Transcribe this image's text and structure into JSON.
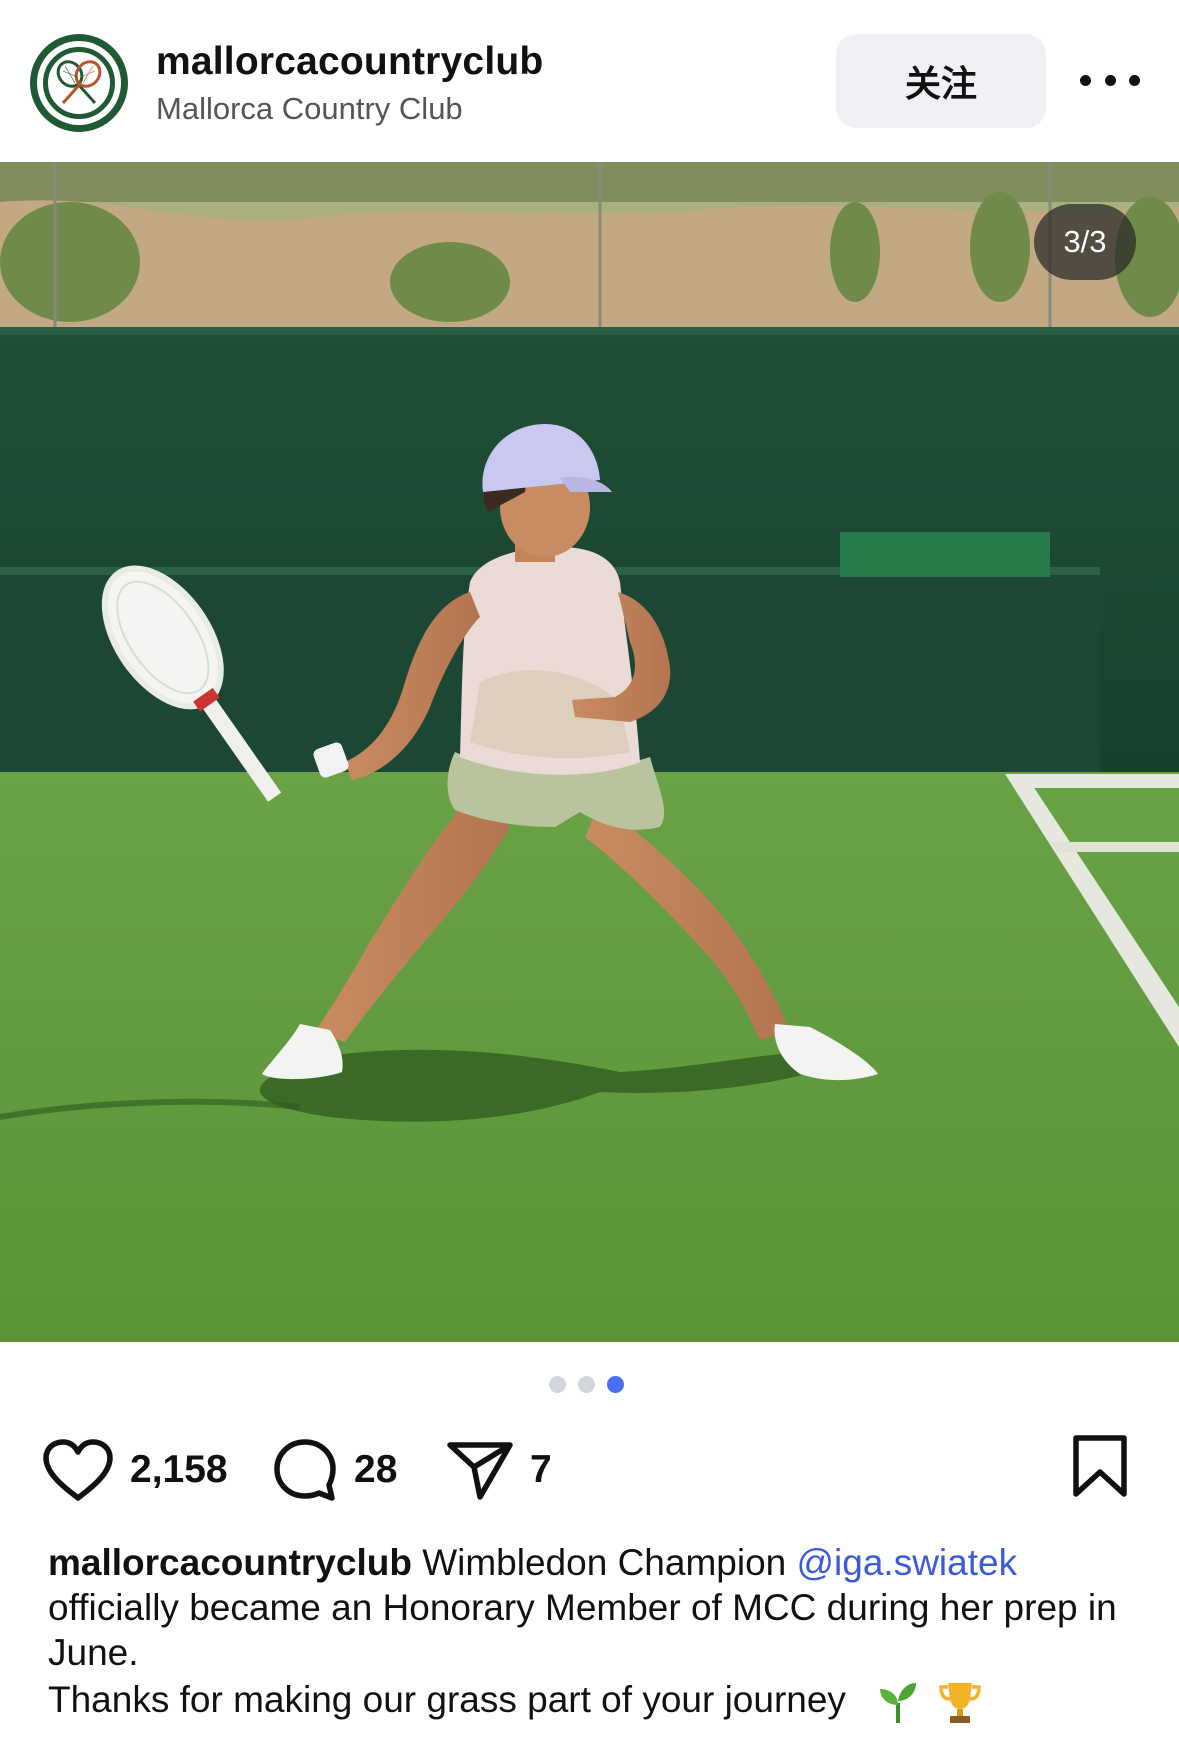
{
  "post": {
    "account": {
      "username": "mallorcacountryclub",
      "display_name": "Mallorca Country Club"
    },
    "follow_label": "关注",
    "image_counter": "3/3",
    "carousel": {
      "total": 3,
      "current": 3
    },
    "stats": {
      "likes": "2,158",
      "comments": "28",
      "shares": "7"
    },
    "caption": {
      "username": "mallorcacountryclub",
      "text_1": " Wimbledon Champion ",
      "mention": "@iga.swiatek",
      "text_2": " officially became an Honorary Member of MCC during her prep in June.",
      "text_3": "Thanks for making our grass part of your journey",
      "emojis": [
        "seedling-emoji",
        "trophy-emoji"
      ]
    },
    "colors": {
      "brand_green": "#1f5a34",
      "mention": "#3b5bdb",
      "active_dot": "#4a6cf7",
      "grass": "#5e9a3a",
      "court_wall": "#1d4a34"
    },
    "icons": [
      "more-icon",
      "heart-icon",
      "comment-icon",
      "share-icon",
      "bookmark-icon"
    ]
  }
}
